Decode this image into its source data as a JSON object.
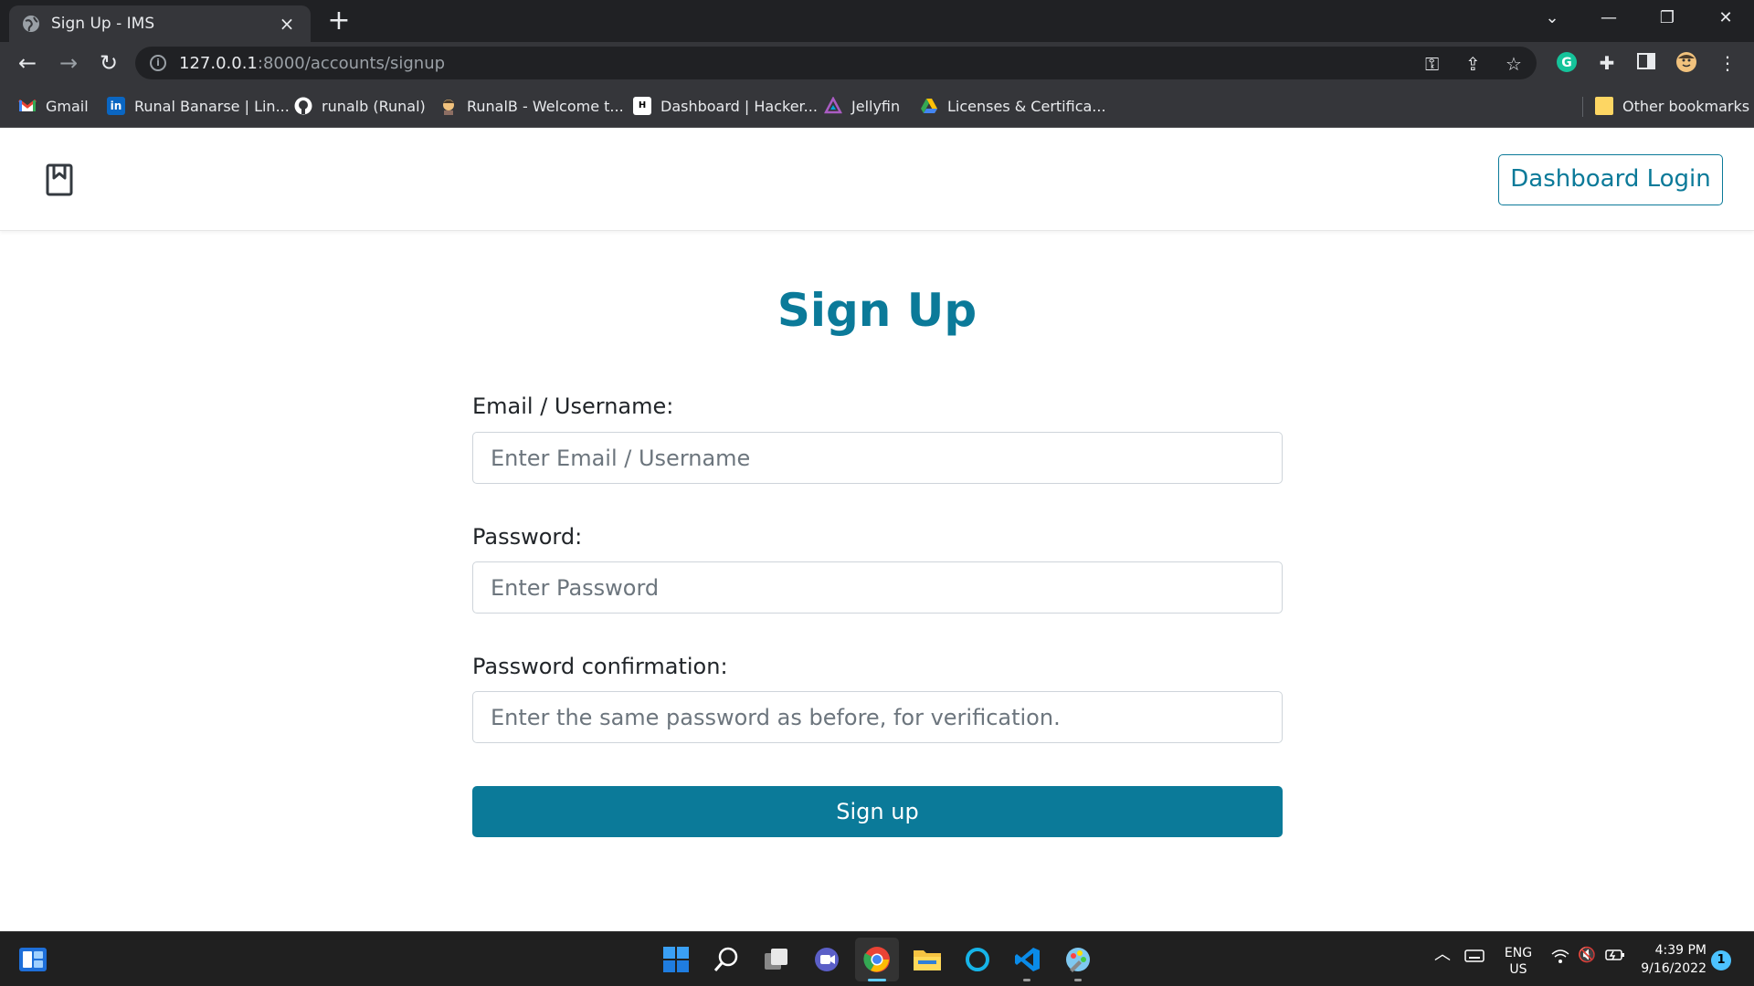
{
  "browser": {
    "tab_title": "Sign Up - IMS",
    "tab_close": "×",
    "new_tab": "+",
    "url_host": "127.0.0.1",
    "url_rest": ":8000/accounts/signup",
    "bookmarks": [
      {
        "label": "Gmail",
        "icon": "gmail-icon"
      },
      {
        "label": "Runal Banarse | Lin...",
        "icon": "linkedin-icon"
      },
      {
        "label": "runalb (Runal)",
        "icon": "github-icon"
      },
      {
        "label": "RunalB - Welcome t...",
        "icon": "avatar-icon"
      },
      {
        "label": "Dashboard | Hacker...",
        "icon": "hackerrank-icon"
      },
      {
        "label": "Jellyfin",
        "icon": "jellyfin-icon"
      },
      {
        "label": "Licenses & Certifica...",
        "icon": "google-drive-icon"
      }
    ],
    "other_bookmarks": "Other bookmarks"
  },
  "site": {
    "dashboard_login": "Dashboard Login"
  },
  "form": {
    "heading": "Sign Up",
    "email_label": "Email / Username:",
    "email_placeholder": "Enter Email / Username",
    "password_label": "Password:",
    "password_placeholder": "Enter Password",
    "confirm_label": "Password confirmation:",
    "confirm_placeholder": "Enter the same password as before, for verification.",
    "submit_label": "Sign up"
  },
  "taskbar": {
    "lang_1": "ENG",
    "lang_2": "US",
    "time": "4:39 PM",
    "date": "9/16/2022",
    "notifications": "1"
  },
  "colors": {
    "accent": "#0b7a99",
    "chrome_dark": "#202124",
    "chrome_toolbar": "#35363a"
  }
}
